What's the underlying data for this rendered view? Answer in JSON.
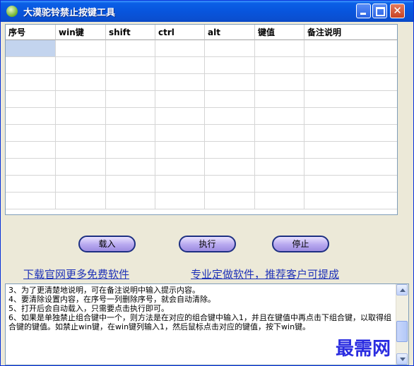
{
  "window": {
    "title": "大漠驼铃禁止按键工具"
  },
  "table": {
    "columns": [
      "序号",
      "win键",
      "shift",
      "ctrl",
      "alt",
      "键值",
      "备注说明"
    ],
    "row_count": 10
  },
  "buttons": {
    "load": "载入",
    "execute": "执行",
    "stop": "停止"
  },
  "links": {
    "download": "下载官网更多免费软件",
    "custom": "专业定做软件，推荐客户可提成"
  },
  "notes": {
    "lines": [
      "3、为了更清楚地说明，可在备注说明中输入提示内容。",
      "4、要清除设置内容，在序号一列删除序号，就会自动清除。",
      "5、打开后会自动载入，只需要点击执行即可。",
      "6、如果是单独禁止组合键中一个，则方法是在对应的组合键中输入1，并且在键值中再点击下组合键，以取得组合键的键值。如禁止win键，在win键列输入1，然后鼠标点击对应的键值，按下win键。"
    ]
  },
  "watermark": "最需网"
}
